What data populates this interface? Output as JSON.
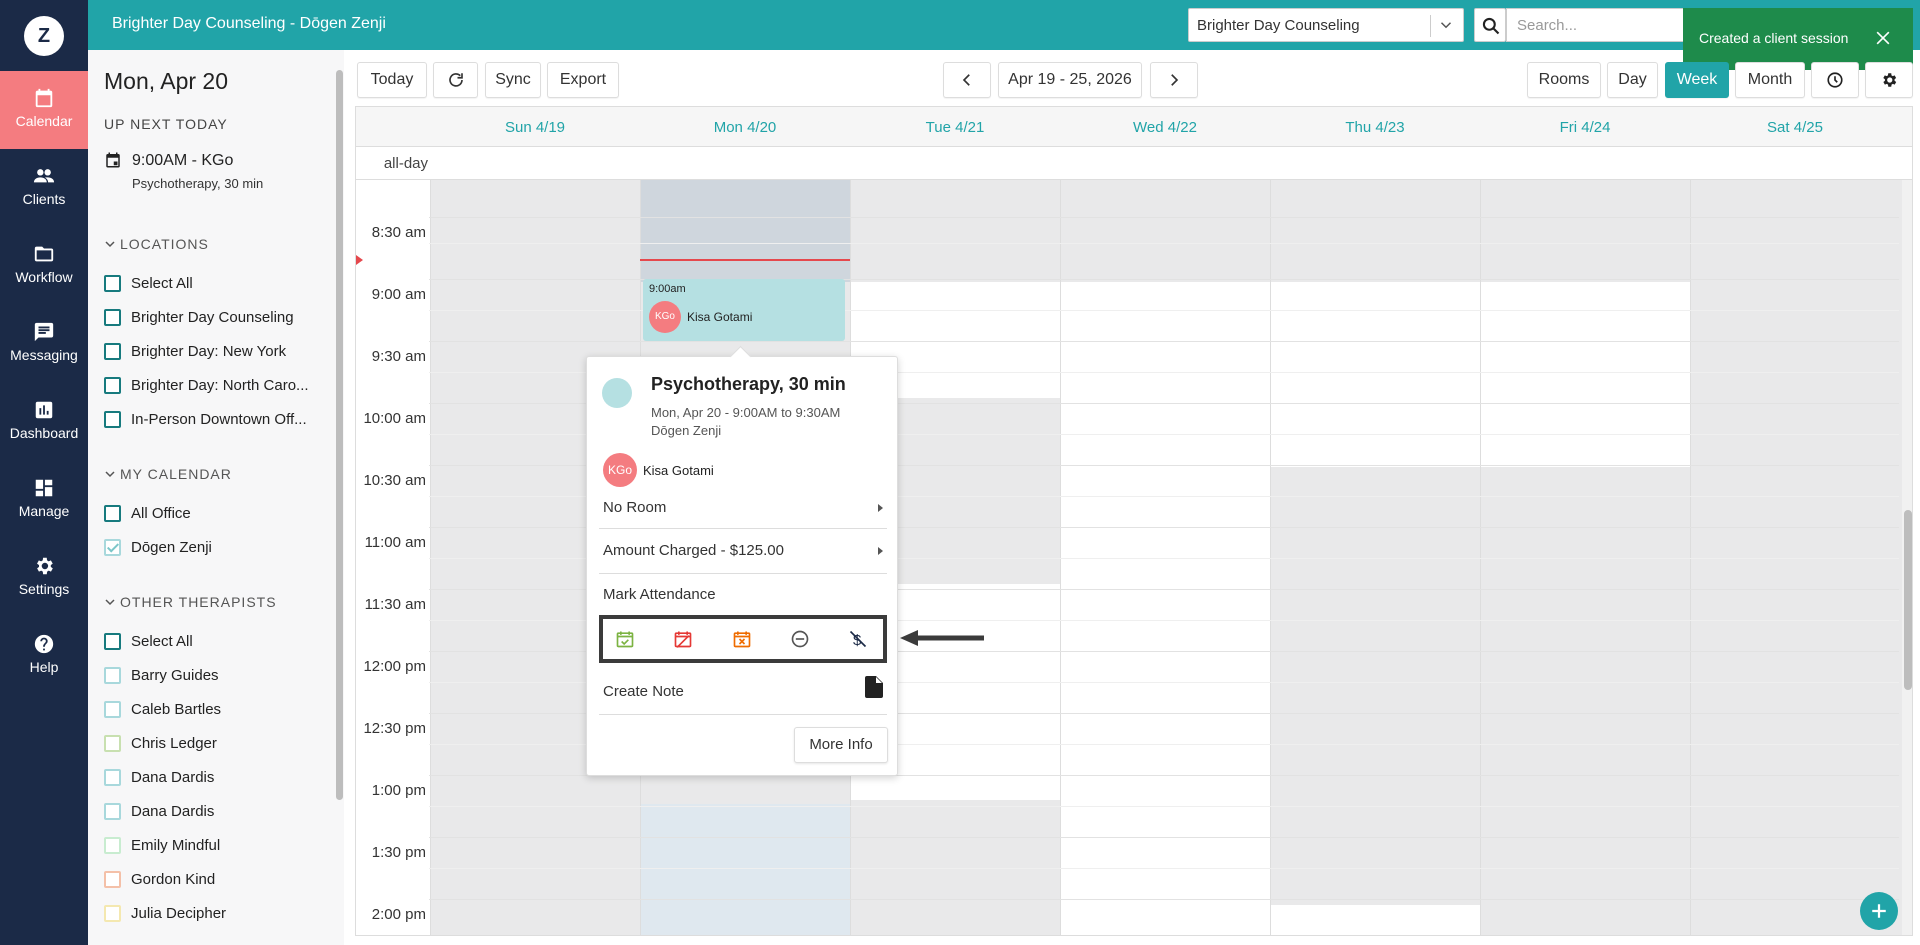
{
  "app": {
    "logo_letter": "Z",
    "title": "Brighter Day Counseling - Dōgen Zenji"
  },
  "nav": {
    "items": [
      {
        "label": "Calendar",
        "icon": "calendar-icon",
        "active": true
      },
      {
        "label": "Clients",
        "icon": "clients-icon"
      },
      {
        "label": "Workflow",
        "icon": "folder-icon"
      },
      {
        "label": "Messaging",
        "icon": "message-icon"
      },
      {
        "label": "Dashboard",
        "icon": "chart-icon"
      },
      {
        "label": "Manage",
        "icon": "dashboard-tiles-icon"
      },
      {
        "label": "Settings",
        "icon": "gear-icon"
      },
      {
        "label": "Help",
        "icon": "help-icon"
      }
    ]
  },
  "header": {
    "location_select": "Brighter Day Counseling",
    "search_placeholder": "Search..."
  },
  "toast": {
    "message": "Created a client session"
  },
  "sidebar": {
    "date": "Mon, Apr 20",
    "up_next_title": "UP NEXT TODAY",
    "up_next_line1": "9:00AM - KGo",
    "up_next_line2": "Psychotherapy, 30 min",
    "locations_title": "LOCATIONS",
    "locations": [
      "Select All",
      "Brighter Day Counseling",
      "Brighter Day: New York",
      "Brighter Day: North Caro...",
      "In-Person Downtown Off..."
    ],
    "my_calendar_title": "MY CALENDAR",
    "my_calendar": [
      {
        "label": "All Office",
        "checked": false
      },
      {
        "label": "Dōgen Zenji",
        "checked": true
      }
    ],
    "other_therapists_title": "OTHER THERAPISTS",
    "other_therapists": [
      {
        "label": "Select All",
        "color": "#177a7e"
      },
      {
        "label": "Barry Guides",
        "color": "#a8d8dc"
      },
      {
        "label": "Caleb Bartles",
        "color": "#a8d8dc"
      },
      {
        "label": "Chris Ledger",
        "color": "#c8e0b0"
      },
      {
        "label": "Dana Dardis",
        "color": "#a8d8dc"
      },
      {
        "label": "Dana Dardis",
        "color": "#a8d8dc"
      },
      {
        "label": "Emily Mindful",
        "color": "#c8ecd0"
      },
      {
        "label": "Gordon Kind",
        "color": "#f4c0a8"
      },
      {
        "label": "Julia Decipher",
        "color": "#f4e8b0"
      }
    ]
  },
  "toolbar": {
    "today": "Today",
    "sync": "Sync",
    "export": "Export",
    "date_range": "Apr 19 - 25, 2026",
    "rooms": "Rooms",
    "day": "Day",
    "week": "Week",
    "month": "Month"
  },
  "calendar": {
    "days": [
      "Sun 4/19",
      "Mon 4/20",
      "Tue 4/21",
      "Wed 4/22",
      "Thu 4/23",
      "Fri 4/24",
      "Sat 4/25"
    ],
    "allday_label": "all-day",
    "times": [
      "8:30 am",
      "9:00 am",
      "9:30 am",
      "10:00 am",
      "10:30 am",
      "11:00 am",
      "11:30 am",
      "12:00 pm",
      "12:30 pm",
      "1:00 pm",
      "1:30 pm",
      "2:00 pm"
    ],
    "event": {
      "time": "9:00am",
      "initials": "KGo",
      "client": "Kisa Gotami"
    }
  },
  "popover": {
    "title": "Psychotherapy, 30 min",
    "time": "Mon, Apr 20 - 9:00AM to 9:30AM",
    "therapist": "Dōgen Zenji",
    "client_initials": "KGo",
    "client": "Kisa Gotami",
    "room": "No Room",
    "amount": "Amount Charged - $125.00",
    "attendance": "Mark Attendance",
    "create_note": "Create Note",
    "more_info": "More Info"
  },
  "colors": {
    "nav_bg": "#1b2a47",
    "accent": "#21a4a8",
    "active_nav": "#f47c80",
    "toast": "#1e8b4b"
  }
}
